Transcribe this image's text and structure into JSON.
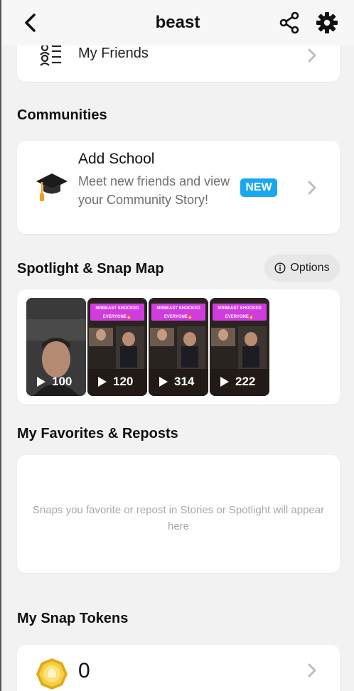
{
  "header": {
    "title": "beast"
  },
  "friends": {
    "label": "My Friends"
  },
  "communities": {
    "title": "Communities",
    "add_school": {
      "title": "Add School",
      "subtitle": "Meet new friends and view your Community Story!",
      "badge": "NEW"
    }
  },
  "spotlight": {
    "title": "Spotlight & Snap Map",
    "options_label": "Options",
    "thumbs": [
      {
        "views": "100",
        "tag": ""
      },
      {
        "views": "120",
        "tag": "MRBEAST SHOCKED EVERYONE🔥"
      },
      {
        "views": "314",
        "tag": "MRBEAST SHOCKED EVERYONE🔥"
      },
      {
        "views": "222",
        "tag": "MRBEAST SHOCKED EVERYONE🔥"
      }
    ]
  },
  "favorites": {
    "title": "My Favorites & Reposts",
    "empty_text": "Snaps you favorite or repost in Stories or Spotlight will appear here"
  },
  "tokens": {
    "title": "My Snap Tokens",
    "value": "0"
  },
  "colors": {
    "accent_blue": "#1aa7f2",
    "tag_purple": "#d13be0",
    "coin_gold": "#f2c230"
  },
  "icons": [
    "back-chevron-icon",
    "share-icon",
    "gear-icon",
    "friends-list-icon",
    "graduation-cap-icon",
    "info-icon",
    "play-icon",
    "token-coin-icon",
    "chevron-right-icon"
  ]
}
